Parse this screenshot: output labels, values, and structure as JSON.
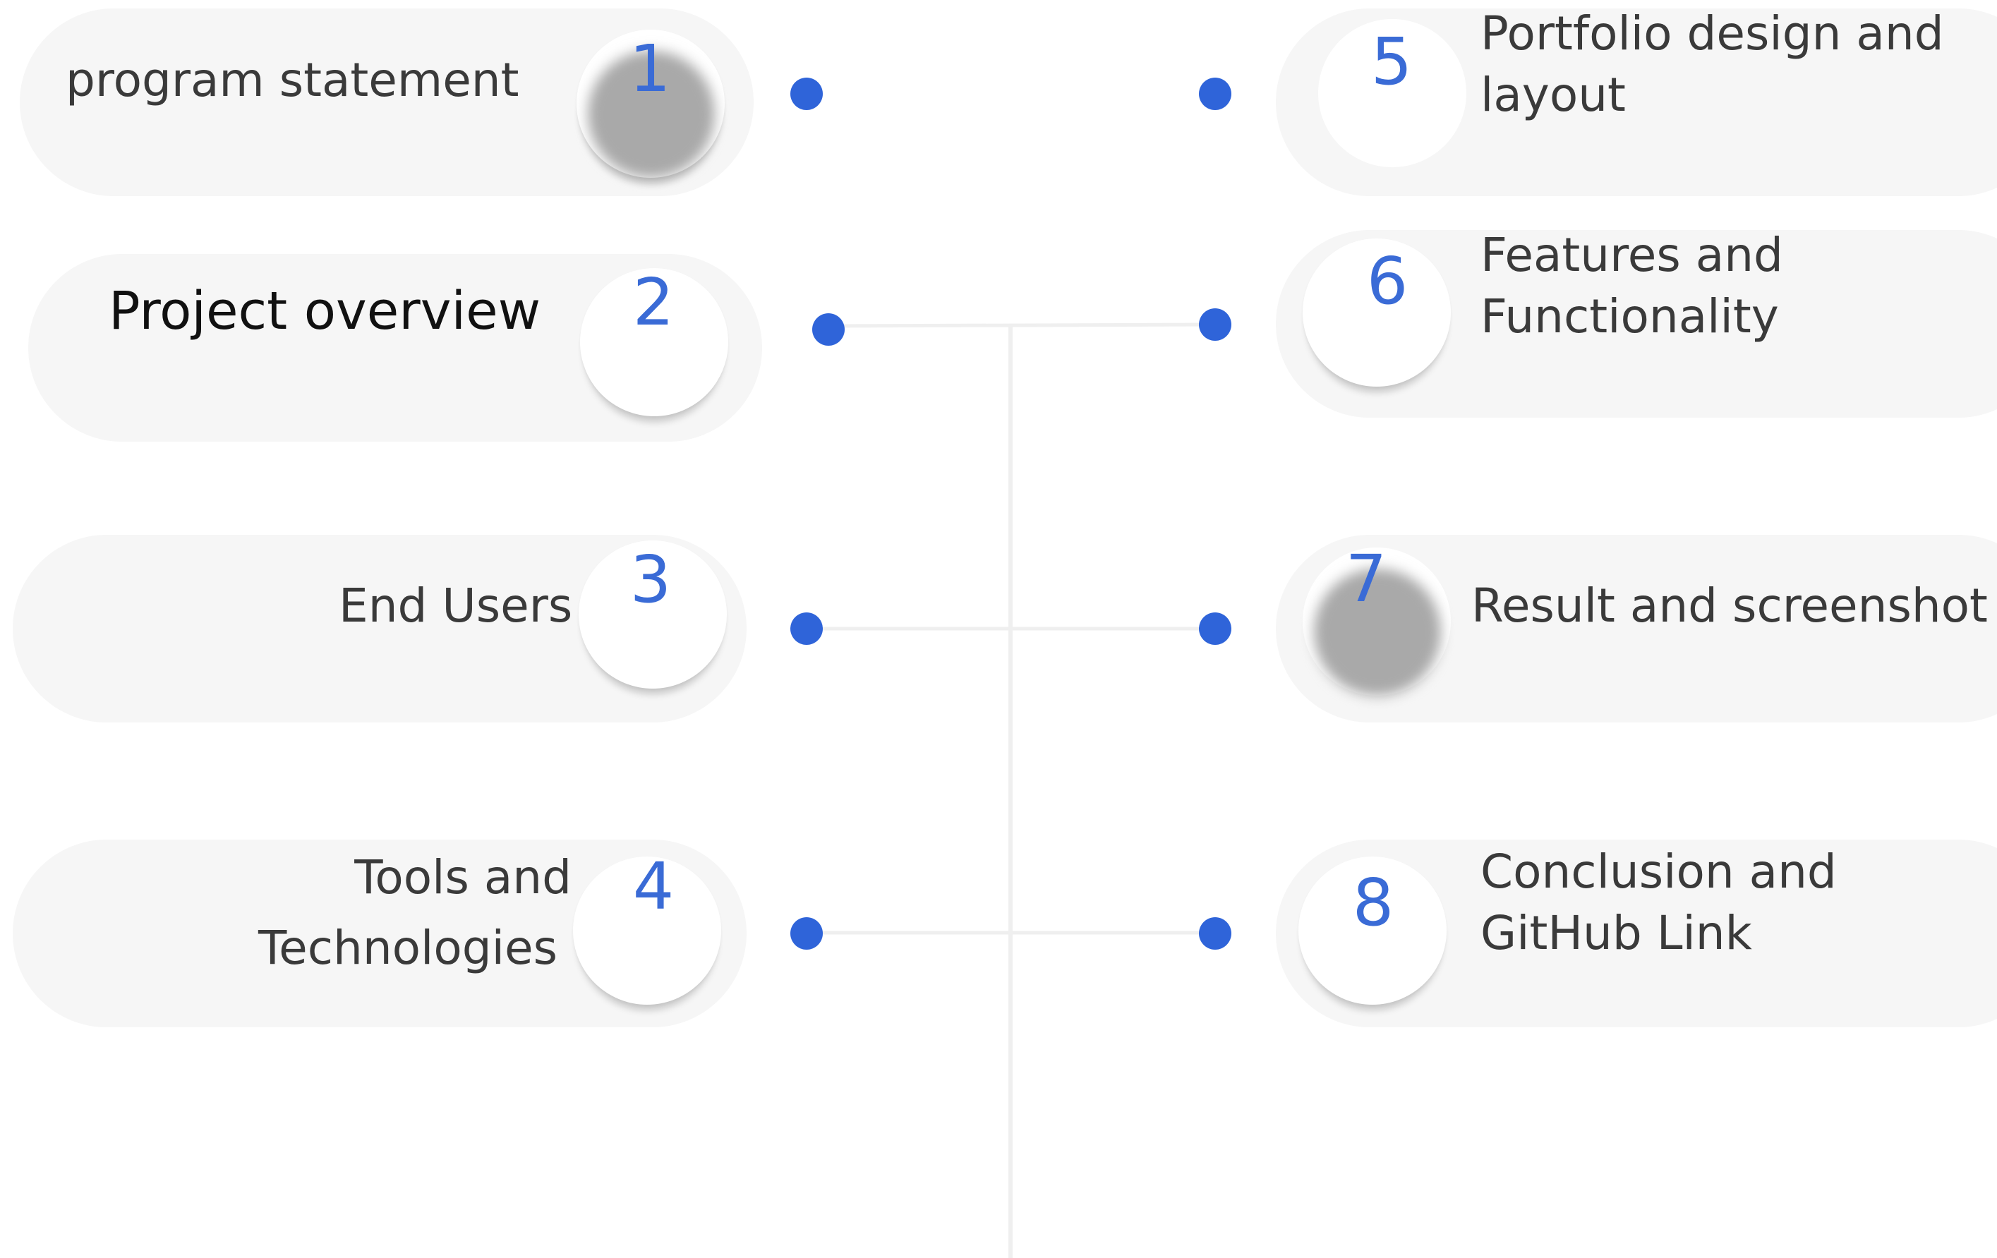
{
  "colors": {
    "accent": "#2f64d9",
    "number": "#3a6bd6",
    "pill": "#f6f6f6",
    "text": "#3a3a3a",
    "connector": "#efefef"
  },
  "items": [
    {
      "number": "1",
      "label": "program statement"
    },
    {
      "number": "2",
      "label": "Project overview"
    },
    {
      "number": "3",
      "label": "End Users"
    },
    {
      "number": "4",
      "label_line1": "Tools and",
      "label_line2": "Technologies"
    },
    {
      "number": "5",
      "label_line1": "Portfolio design and",
      "label_line2": "layout"
    },
    {
      "number": "6",
      "label_line1": "Features  and",
      "label_line2": "Functionality"
    },
    {
      "number": "7",
      "label": "Result and screenshot"
    },
    {
      "number": "8",
      "label_line1": "Conclusion and",
      "label_line2": "GitHub Link"
    }
  ]
}
